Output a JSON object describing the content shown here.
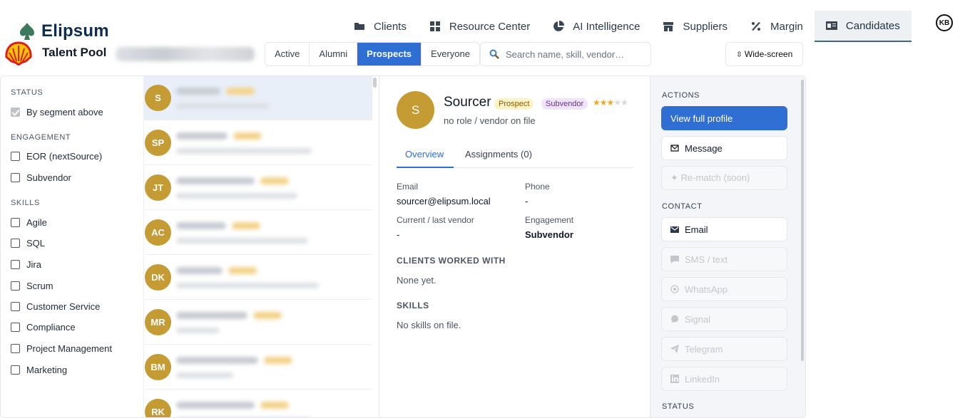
{
  "brand": {
    "name": "Elipsum"
  },
  "nav": {
    "items": [
      {
        "label": "Clients",
        "icon": "folder-icon"
      },
      {
        "label": "Resource Center",
        "icon": "grid-icon"
      },
      {
        "label": "AI Intelligence",
        "icon": "pie-chart-icon"
      },
      {
        "label": "Suppliers",
        "icon": "store-icon"
      },
      {
        "label": "Margin",
        "icon": "percent-icon"
      },
      {
        "label": "Candidates",
        "icon": "id-card-icon",
        "active": true
      }
    ],
    "user_initials": "KB"
  },
  "subheader": {
    "title": "Talent Pool",
    "segments": [
      "Active",
      "Alumni",
      "Prospects",
      "Everyone"
    ],
    "active_segment": "Prospects",
    "search_placeholder": "Search name, skill, vendor…",
    "wide_screen_label": "Wide-screen"
  },
  "filters": {
    "status_head": "STATUS",
    "status_option": "By segment above",
    "engagement_head": "ENGAGEMENT",
    "engagement_options": [
      "EOR (nextSource)",
      "Subvendor"
    ],
    "skills_head": "SKILLS",
    "skills_options": [
      "Agile",
      "SQL",
      "Jira",
      "Scrum",
      "Customer Service",
      "Compliance",
      "Project Management",
      "Marketing"
    ]
  },
  "list": {
    "rows": [
      {
        "initials": "S"
      },
      {
        "initials": "SP"
      },
      {
        "initials": "JT"
      },
      {
        "initials": "AC"
      },
      {
        "initials": "DK"
      },
      {
        "initials": "MR"
      },
      {
        "initials": "BM"
      },
      {
        "initials": "RK"
      }
    ]
  },
  "detail": {
    "initials": "S",
    "name": "Sourcer",
    "badges": [
      "Prospect",
      "Subvendor"
    ],
    "rating": 3,
    "rating_max": 5,
    "role": "no role / vendor on file",
    "tabs": [
      "Overview",
      "Assignments (0)"
    ],
    "email_label": "Email",
    "email_value": "sourcer@elipsum.local",
    "phone_label": "Phone",
    "phone_value": "-",
    "vendor_label": "Current / last vendor",
    "vendor_value": "-",
    "engagement_label": "Engagement",
    "engagement_value": "Subvendor",
    "clients_head": "CLIENTS WORKED WITH",
    "clients_body": "None yet.",
    "skills_head": "SKILLS",
    "skills_body": "No skills on file."
  },
  "actions": {
    "actions_head": "ACTIONS",
    "view_profile": "View full profile",
    "message": "Message",
    "rematch": "✦ Re-match (soon)",
    "contact_head": "CONTACT",
    "contact_email": "Email",
    "sms": "SMS / text",
    "whatsapp": "WhatsApp",
    "signal": "Signal",
    "telegram": "Telegram",
    "linkedin": "LinkedIn",
    "status_head": "STATUS"
  }
}
